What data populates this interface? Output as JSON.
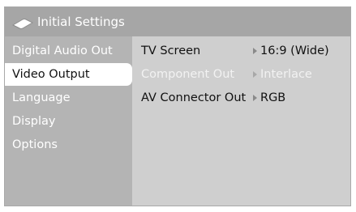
{
  "window": {
    "title": "Initial Settings",
    "icon": "remote-control-icon"
  },
  "sidebar": {
    "items": [
      {
        "label": "Digital Audio Out",
        "selected": false
      },
      {
        "label": "Video Output",
        "selected": true
      },
      {
        "label": "Language",
        "selected": false
      },
      {
        "label": "Display",
        "selected": false
      },
      {
        "label": "Options",
        "selected": false
      }
    ]
  },
  "settings": {
    "rows": [
      {
        "label": "TV Screen",
        "value": "16:9 (Wide)",
        "enabled": true
      },
      {
        "label": "Component Out",
        "value": "Interlace",
        "enabled": false
      },
      {
        "label": "AV Connector Out",
        "value": "RGB",
        "enabled": true
      }
    ]
  },
  "colors": {
    "titlebar": "#a6a6a6",
    "sidebar": "#b4b4b4",
    "content": "#cfcfcf",
    "selected_item": "#ffffff",
    "enabled_text": "#111111",
    "disabled_text": "#f2f2f2"
  }
}
